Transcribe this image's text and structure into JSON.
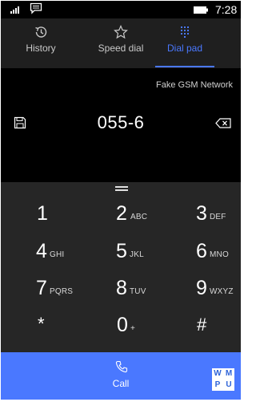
{
  "status": {
    "time": "7:28",
    "signal_icon": "signal-bars-icon",
    "message_icon": "message-icon",
    "battery_icon": "battery-icon"
  },
  "tabs": [
    {
      "label": "History",
      "icon": "history-icon",
      "active": false
    },
    {
      "label": "Speed dial",
      "icon": "star-icon",
      "active": false
    },
    {
      "label": "Dial pad",
      "icon": "dialpad-icon",
      "active": true
    }
  ],
  "display": {
    "network": "Fake GSM Network",
    "number": "055-6"
  },
  "keypad": {
    "keys": [
      {
        "digit": "1",
        "letters": ""
      },
      {
        "digit": "2",
        "letters": "ABC"
      },
      {
        "digit": "3",
        "letters": "DEF"
      },
      {
        "digit": "4",
        "letters": "GHI"
      },
      {
        "digit": "5",
        "letters": "JKL"
      },
      {
        "digit": "6",
        "letters": "MNO"
      },
      {
        "digit": "7",
        "letters": "PQRS"
      },
      {
        "digit": "8",
        "letters": "TUV"
      },
      {
        "digit": "9",
        "letters": "WXYZ"
      },
      {
        "digit": "*",
        "letters": ""
      },
      {
        "digit": "0",
        "letters": "+"
      },
      {
        "digit": "#",
        "letters": ""
      }
    ]
  },
  "call": {
    "label": "Call"
  },
  "logo": {
    "letters": [
      "W",
      "M",
      "P",
      "U"
    ]
  },
  "colors": {
    "accent": "#4a78ff",
    "tabs_bg": "#1f1f1f",
    "keypad_bg": "#262626",
    "display_bg": "#000000"
  }
}
